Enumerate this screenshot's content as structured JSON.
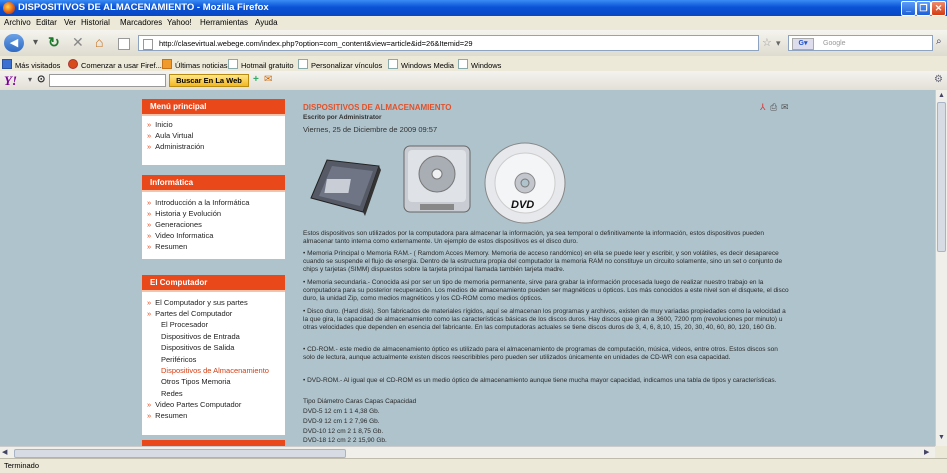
{
  "window": {
    "title": "DISPOSITIVOS DE ALMACENAMIENTO - Mozilla Firefox"
  },
  "menubar": {
    "items": [
      "Archivo",
      "Editar",
      "Ver",
      "Historial",
      "Marcadores",
      "Yahoo!",
      "Herramientas",
      "Ayuda"
    ]
  },
  "navbar": {
    "url": "http://clasevirtual.webege.com/index.php?option=com_content&view=article&id=26&Itemid=29",
    "search_placeholder": "Google"
  },
  "bookmarks": {
    "items": [
      "Más visitados",
      "Comenzar a usar Firef...",
      "Últimas noticias",
      "Hotmail gratuito",
      "Personalizar vínculos",
      "Windows Media",
      "Windows"
    ]
  },
  "yahoo_toolbar": {
    "logo": "Y!",
    "button": "Buscar En La Web"
  },
  "sidebar": {
    "menu_principal": {
      "title": "Menú principal",
      "items": [
        "Inicio",
        "Aula Virtual",
        "Administración"
      ]
    },
    "informatica": {
      "title": "Informática",
      "items": [
        "Introducción a la Informática",
        "Historia y Evolución",
        "Generaciones",
        "Video Informatica",
        "Resumen"
      ]
    },
    "computador": {
      "title": "El Computador",
      "items": [
        "El Computador y sus partes",
        "Partes del Computador",
        "El Procesador",
        "Dispositivos de Entrada",
        "Dispositivos de Salida",
        "Periféricos",
        "Dispositivos de Almacenamiento",
        "Otros Tipos Memoria",
        "Redes",
        "Video Partes Computador",
        "Resumen"
      ]
    }
  },
  "article": {
    "title": "DISPOSITIVOS DE ALMACENAMIENTO",
    "author": "Escrito por Administrator",
    "date": "Viernes, 25 de Diciembre de 2009 09:57",
    "dvd_label": "DVD",
    "paragraphs": [
      "Estos dispositivos son utilizados por la computadora para almacenar la información, ya sea temporal o definitivamente la información, estos dispositivos pueden almacenar tanto interna como externamente. Un ejemplo de estos dispositivos es el disco duro.",
      "• Memoria Principal o Memoria RAM.- ( Ramdom Acces Memory. Memoria de acceso randómico) en ella se puede leer y escribir, y son volátiles, es decir desaparece cuando se suspende el flujo de energía. Dentro de la estructura propia del computador la memoria RAM no constituye un circuito solamente, sino un set o conjunto de chips y tarjetas (SIMM) dispuestos sobre la tarjeta principal llamada también tarjeta madre.",
      "• Memoria secundaria.- Conocida asi por ser un tipo de memoria permanente, sirve para grabar la información procesada luego de realizar nuestro trabajo en la computadora para su posterior recuperación. Los medios de almacenamiento pueden ser magnéticos u ópticos. Los más conocidos a este nivel son el disquete, el disco duro, la unidad Zip, como medios magnéticos y los CD-ROM como medios ópticos.",
      "• Disco duro. (Hard disk). Son fabricados de materiales rígidos, aquí se almacenan los programas y archivos, existen de muy variadas propiedades como la velocidad a la que gira, la capacidad de almacenamiento como las características básicas de los discos duros. Hay discos que giran a 3600, 7200 rpm (revoluciones por minuto) u otras velocidades que dependen en esencia del fabricante. En las computadoras actuales se tiene discos duros de 3, 4, 6, 8,10, 15, 20, 30, 40, 60, 80, 120, 160 Gb.",
      "• CD-ROM.- este medio de almacenamiento óptico es utilizado para el almacenamiento de programas de computación, música, videos, entre otros. Estos discos son solo de lectura, aunque actualmente existen discos reescribibles pero pueden ser utilizados únicamente en unidades de CD-WR con esa capacidad.",
      "• DVD-ROM.- Al igual que el CD-ROM es un medio óptico de almacenamiento aunque tiene mucha mayor capacidad, indicamos una tabla de tipos y características."
    ],
    "table": {
      "header": "Tipo Diámetro Caras Capas Capacidad",
      "rows": [
        "DVD-5 12 cm 1 1 4,38 Gb.",
        "DVD-9 12 cm 1 2 7,96 Gb.",
        "DVD-10 12 cm 2 1 8,75 Gb.",
        "DVD-18 12 cm 2 2 15,90 Gb."
      ]
    }
  },
  "status": {
    "text": "Terminado"
  }
}
